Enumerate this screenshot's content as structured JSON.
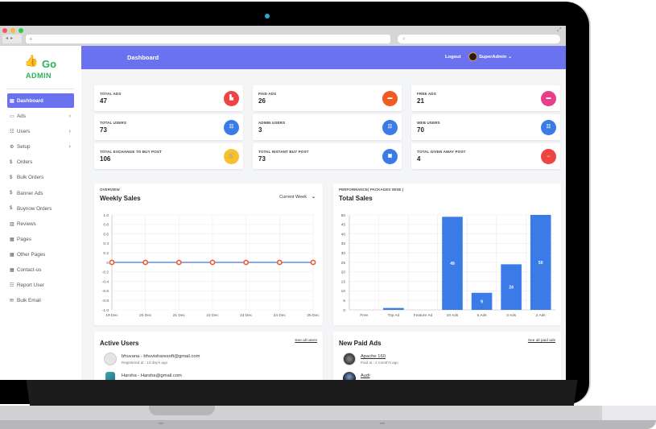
{
  "browser": {
    "url_placeholder": "+",
    "search_placeholder": "⌕",
    "traffic_lights": [
      "#f25a5a",
      "#f6bd2b",
      "#27c94e"
    ]
  },
  "brand": {
    "logo_word": "Go",
    "logo_sub": "ADMIN",
    "color": "#2bb35a"
  },
  "header": {
    "title": "Dashboard",
    "logout": "Logout",
    "user": "SuperAdmin",
    "bg": "#6a72f0"
  },
  "sidebar": {
    "items": [
      {
        "label": "Dashboard",
        "icon": "▤",
        "active": true,
        "has_children": false
      },
      {
        "label": "Ads",
        "icon": "▭",
        "active": false,
        "has_children": true
      },
      {
        "label": "Users",
        "icon": "☷",
        "active": false,
        "has_children": true
      },
      {
        "label": "Setup",
        "icon": "⚙",
        "active": false,
        "has_children": true
      },
      {
        "label": "Orders",
        "icon": "$",
        "active": false,
        "has_children": false
      },
      {
        "label": "Bulk Orders",
        "icon": "$",
        "active": false,
        "has_children": false
      },
      {
        "label": "Banner Ads",
        "icon": "$",
        "active": false,
        "has_children": false
      },
      {
        "label": "Buynow Orders",
        "icon": "$",
        "active": false,
        "has_children": false
      },
      {
        "label": "Reviews",
        "icon": "▥",
        "active": false,
        "has_children": false
      },
      {
        "label": "Pages",
        "icon": "▦",
        "active": false,
        "has_children": false
      },
      {
        "label": "Other Pages",
        "icon": "▦",
        "active": false,
        "has_children": false
      },
      {
        "label": "Contact-us",
        "icon": "▦",
        "active": false,
        "has_children": false
      },
      {
        "label": "Report User",
        "icon": "☷",
        "active": false,
        "has_children": false
      },
      {
        "label": "Bulk Email",
        "icon": "✉",
        "active": false,
        "has_children": false
      }
    ]
  },
  "stats": [
    {
      "label": "TOTAL ADS",
      "value": "47",
      "icon": "chart-icon",
      "glyph": "▙",
      "color": "#ef4444"
    },
    {
      "label": "PAID ADS",
      "value": "26",
      "icon": "card-icon",
      "glyph": "▬",
      "color": "#f15a22"
    },
    {
      "label": "FREE ADS",
      "value": "21",
      "icon": "card-icon",
      "glyph": "▬",
      "color": "#e83e8c"
    },
    {
      "label": "TOTAL USERS",
      "value": "73",
      "icon": "users-icon",
      "glyph": "☷",
      "color": "#3b7be8"
    },
    {
      "label": "ADMIN USERS",
      "value": "3",
      "icon": "users-icon",
      "glyph": "☷",
      "color": "#3b7be8"
    },
    {
      "label": "WEB USERS",
      "value": "70",
      "icon": "users-icon",
      "glyph": "☷",
      "color": "#3b7be8"
    },
    {
      "label": "TOTAL EXCHANGE TO BUY POST",
      "value": "106",
      "icon": "cart-icon",
      "glyph": "🛒",
      "color": "#f8c02c"
    },
    {
      "label": "TOTAL INSTANT BUY POST",
      "value": "73",
      "icon": "image-icon",
      "glyph": "▣",
      "color": "#3b7be8"
    },
    {
      "label": "TOTAL GIVEN AWAY POST",
      "value": "4",
      "icon": "arrows-icon",
      "glyph": "↔",
      "color": "#ef4444"
    }
  ],
  "weekly_sales": {
    "eyebrow": "OVERVIEW",
    "title": "Weekly Sales",
    "dropdown": "Current Week"
  },
  "total_sales": {
    "eyebrow": "PERFORMANCE( PACKAGES WISE )",
    "title": "Total Sales"
  },
  "chart_data": [
    {
      "type": "line",
      "title": "Weekly Sales",
      "x": [
        "19 Dec",
        "20 Dec",
        "21 Dec",
        "22 Dec",
        "23 Dec",
        "24 Dec",
        "25 Dec"
      ],
      "series": [
        {
          "name": "Sales",
          "values": [
            0,
            0,
            0,
            0,
            0,
            0,
            0
          ],
          "color": "#5b8def",
          "marker_color": "#f05a28"
        }
      ],
      "ylim": [
        -1.0,
        1.0
      ],
      "yticks": [
        "1.0",
        "0.8",
        "0.6",
        "0.4",
        "0.2",
        "0",
        "-0.2",
        "-0.4",
        "-0.6",
        "-0.8",
        "-1.0"
      ],
      "grid": true,
      "xlabel": "",
      "ylabel": ""
    },
    {
      "type": "bar",
      "title": "Total Sales",
      "categories": [
        "Free",
        "Top Ad",
        "Feature Ad",
        "10 Ads",
        "6 Ads",
        "3 Ads",
        "2 Ads"
      ],
      "values": [
        0,
        1,
        0,
        49,
        9,
        24,
        50
      ],
      "data_labels": [
        "",
        "",
        "",
        "49",
        "9",
        "24",
        "50"
      ],
      "color": "#3b7be8",
      "ylim": [
        0,
        50
      ],
      "yticks": [
        "50",
        "45",
        "40",
        "35",
        "30",
        "25",
        "20",
        "15",
        "10",
        "5",
        "0"
      ],
      "grid": true,
      "xlabel": "",
      "ylabel": ""
    }
  ],
  "active_users": {
    "title": "Active Users",
    "see_all": "See all users",
    "items": [
      {
        "name": "bhuvana - bhuvisharesoft@gmail.com",
        "sub": "Registered at : 13 day's ago"
      },
      {
        "name": "Harsha - Harsha@gmail.com",
        "sub": ""
      }
    ]
  },
  "paid_ads": {
    "title": "New Paid Ads",
    "see_all": "See all paid ads",
    "items": [
      {
        "name": "Apache 160",
        "sub": "Paid at : 4 month's ago"
      },
      {
        "name": "Audi",
        "sub": ""
      }
    ]
  }
}
